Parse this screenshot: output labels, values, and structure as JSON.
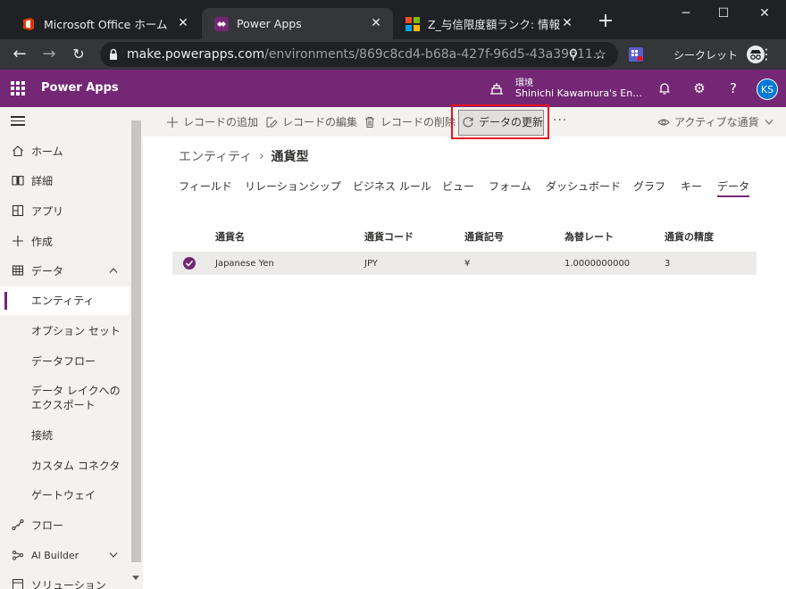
{
  "browser": {
    "tabs": [
      {
        "title": "Microsoft Office ホーム",
        "active": false
      },
      {
        "title": "Power Apps",
        "active": true
      },
      {
        "title": "Z_与信限度額ランク: 情報（全",
        "active": false
      }
    ],
    "url_host": "make.powerapps.com",
    "url_path": "/environments/869c8cd4-b68a-427f-96d5-43a39611...",
    "incognito_label": "シークレット"
  },
  "header": {
    "app_name": "Power Apps",
    "env_label": "環境",
    "env_name": "Shinichi Kawamura's En...",
    "avatar_initials": "KS",
    "brand_color": "#742774"
  },
  "sidebar": {
    "items": [
      {
        "label": "ホーム",
        "icon": "home-icon"
      },
      {
        "label": "詳細",
        "icon": "book-icon"
      },
      {
        "label": "アプリ",
        "icon": "apps-icon"
      },
      {
        "label": "作成",
        "icon": "plus-icon"
      },
      {
        "label": "データ",
        "icon": "table-icon"
      },
      {
        "label": "エンティティ"
      },
      {
        "label": "オプション セット"
      },
      {
        "label": "データフロー"
      },
      {
        "label": "データ レイクへのエクスポート"
      },
      {
        "label": "接続"
      },
      {
        "label": "カスタム コネクタ"
      },
      {
        "label": "ゲートウェイ"
      },
      {
        "label": "フロー",
        "icon": "flow-icon"
      },
      {
        "label": "AI Builder",
        "icon": "ai-builder-icon"
      },
      {
        "label": "ソリューション",
        "icon": "solution-icon"
      }
    ]
  },
  "commands": {
    "add": "レコードの追加",
    "edit": "レコードの編集",
    "delete": "レコードの削除",
    "refresh": "データの更新",
    "more": "···",
    "view": "アクティブな通貨"
  },
  "breadcrumb": {
    "parent": "エンティティ",
    "current": "通貨型"
  },
  "tabs": [
    "フィールド",
    "リレーションシップ",
    "ビジネス ルール",
    "ビュー",
    "フォーム",
    "ダッシュボード",
    "グラフ",
    "キー",
    "データ"
  ],
  "active_tab": "データ",
  "grid": {
    "columns": [
      "通貨名",
      "通貨コード",
      "通貨記号",
      "為替レート",
      "通貨の精度"
    ],
    "rows": [
      [
        "Japanese Yen",
        "JPY",
        "¥",
        "1.0000000000",
        "3"
      ]
    ]
  }
}
